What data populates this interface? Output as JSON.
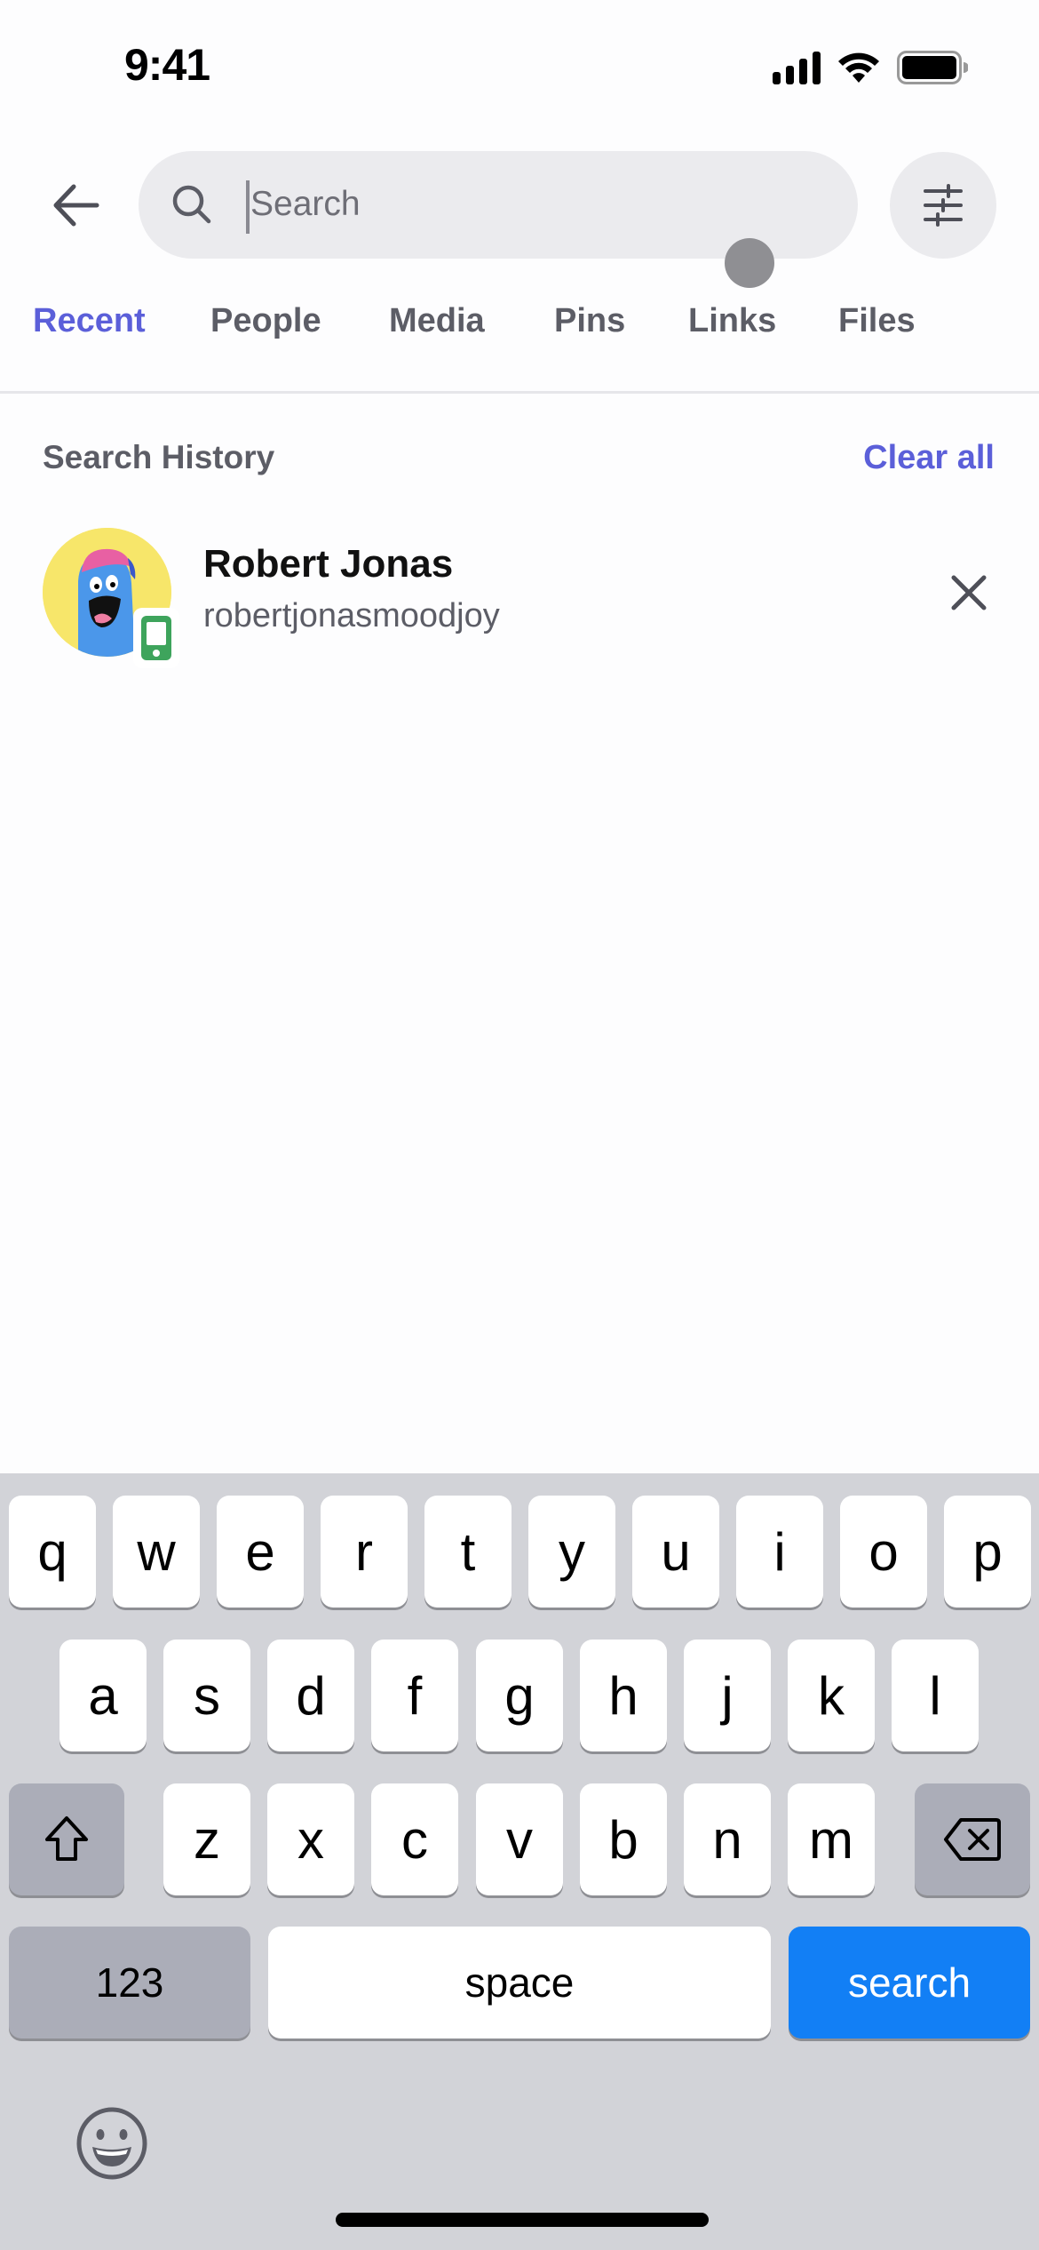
{
  "status_bar": {
    "time": "9:41",
    "icons": [
      "cellular-signal-icon",
      "wifi-icon",
      "battery-icon"
    ]
  },
  "header": {
    "back_icon": "arrow-left-icon",
    "search": {
      "value": "",
      "placeholder": "Search",
      "icon": "search-icon"
    },
    "filter_icon": "sliders-icon"
  },
  "tabs": [
    {
      "label": "Recent",
      "active": true
    },
    {
      "label": "People",
      "active": false
    },
    {
      "label": "Media",
      "active": false
    },
    {
      "label": "Pins",
      "active": false
    },
    {
      "label": "Links",
      "active": false
    },
    {
      "label": "Files",
      "active": false
    }
  ],
  "search_history": {
    "title": "Search History",
    "clear_label": "Clear all",
    "items": [
      {
        "display_name": "Robert Jonas",
        "username": "robertjonasmoodjoy",
        "status_icon": "mobile-online-icon",
        "remove_icon": "close-icon"
      }
    ]
  },
  "keyboard": {
    "row1": [
      "q",
      "w",
      "e",
      "r",
      "t",
      "y",
      "u",
      "i",
      "o",
      "p"
    ],
    "row2": [
      "a",
      "s",
      "d",
      "f",
      "g",
      "h",
      "j",
      "k",
      "l"
    ],
    "row3": [
      "z",
      "x",
      "c",
      "v",
      "b",
      "n",
      "m"
    ],
    "shift_icon": "shift-icon",
    "delete_icon": "backspace-icon",
    "numbers_label": "123",
    "space_label": "space",
    "return_label": "search",
    "emoji_icon": "emoji-icon"
  },
  "colors": {
    "accent": "#5b5fd9",
    "keyboard_return": "#127ff5",
    "online_mobile": "#3ea45c"
  }
}
